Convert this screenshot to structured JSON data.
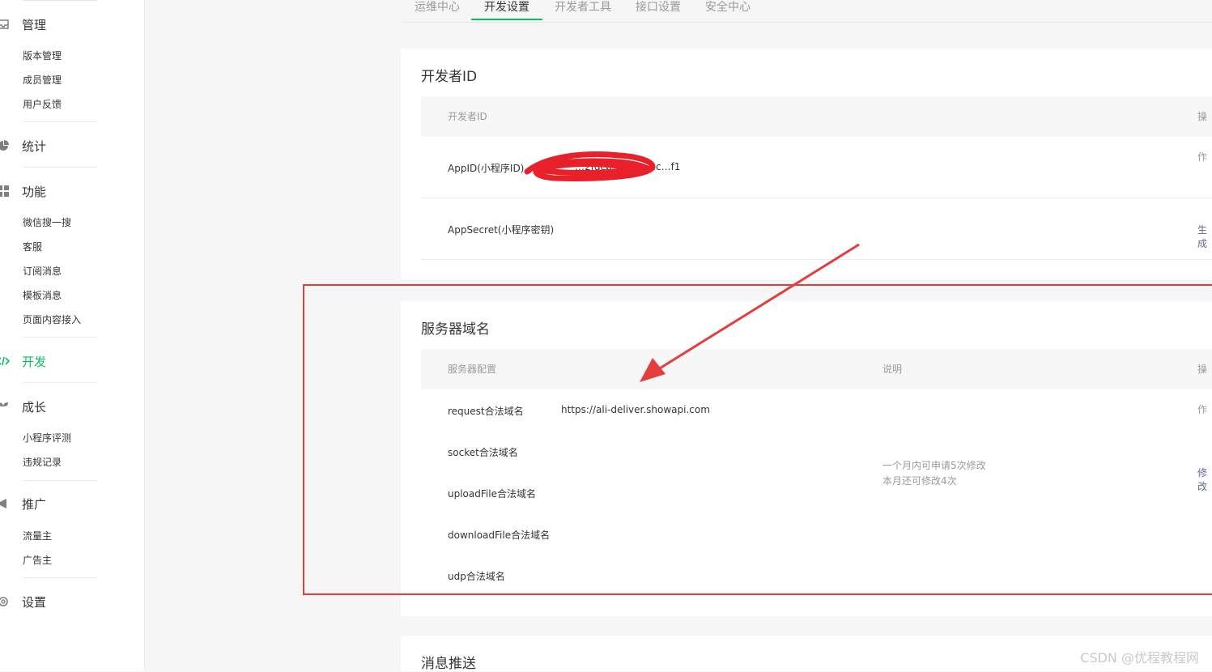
{
  "sidebar": {
    "groups": [
      {
        "label": "管理",
        "icon": "inbox-icon",
        "items": [
          "版本管理",
          "成员管理",
          "用户反馈"
        ]
      },
      {
        "label": "统计",
        "icon": "pie-chart-icon",
        "items": []
      },
      {
        "label": "功能",
        "icon": "grid-icon",
        "items": [
          "微信搜一搜",
          "客服",
          "订阅消息",
          "模板消息",
          "页面内容接入"
        ]
      },
      {
        "label": "开发",
        "icon": "code-icon",
        "items": []
      },
      {
        "label": "成长",
        "icon": "sprout-icon",
        "items": [
          "小程序评测",
          "违规记录"
        ]
      },
      {
        "label": "推广",
        "icon": "megaphone-icon",
        "items": [
          "流量主",
          "广告主"
        ]
      },
      {
        "label": "设置",
        "icon": "gear-icon",
        "items": []
      }
    ]
  },
  "tabs": [
    "运维中心",
    "开发设置",
    "开发者工具",
    "接口设置",
    "安全中心"
  ],
  "developer_id": {
    "title": "开发者ID",
    "col_name": "开发者ID",
    "col_action": "操作",
    "appid_label": "AppID(小程序ID)",
    "appid_value": "…2fdcb…545e…c…f1",
    "appsecret_label": "AppSecret(小程序密钥)",
    "appsecret_action": "生成"
  },
  "server_domain": {
    "title": "服务器域名",
    "col_config": "服务器配置",
    "col_desc": "说明",
    "col_action": "操作",
    "rows": [
      {
        "label": "request合法域名",
        "value": "https://ali-deliver.showapi.com"
      },
      {
        "label": "socket合法域名",
        "value": ""
      },
      {
        "label": "uploadFile合法域名",
        "value": ""
      },
      {
        "label": "downloadFile合法域名",
        "value": ""
      },
      {
        "label": "udp合法域名",
        "value": ""
      }
    ],
    "desc_line1": "一个月内可申请5次修改",
    "desc_line2": "本月还可修改4次",
    "action": "修改"
  },
  "message_push": {
    "title": "消息推送"
  },
  "watermark": "CSDN @优程教程网",
  "colors": {
    "accent": "#07c160",
    "annotation": "#e43d3d",
    "link": "#576b95"
  }
}
